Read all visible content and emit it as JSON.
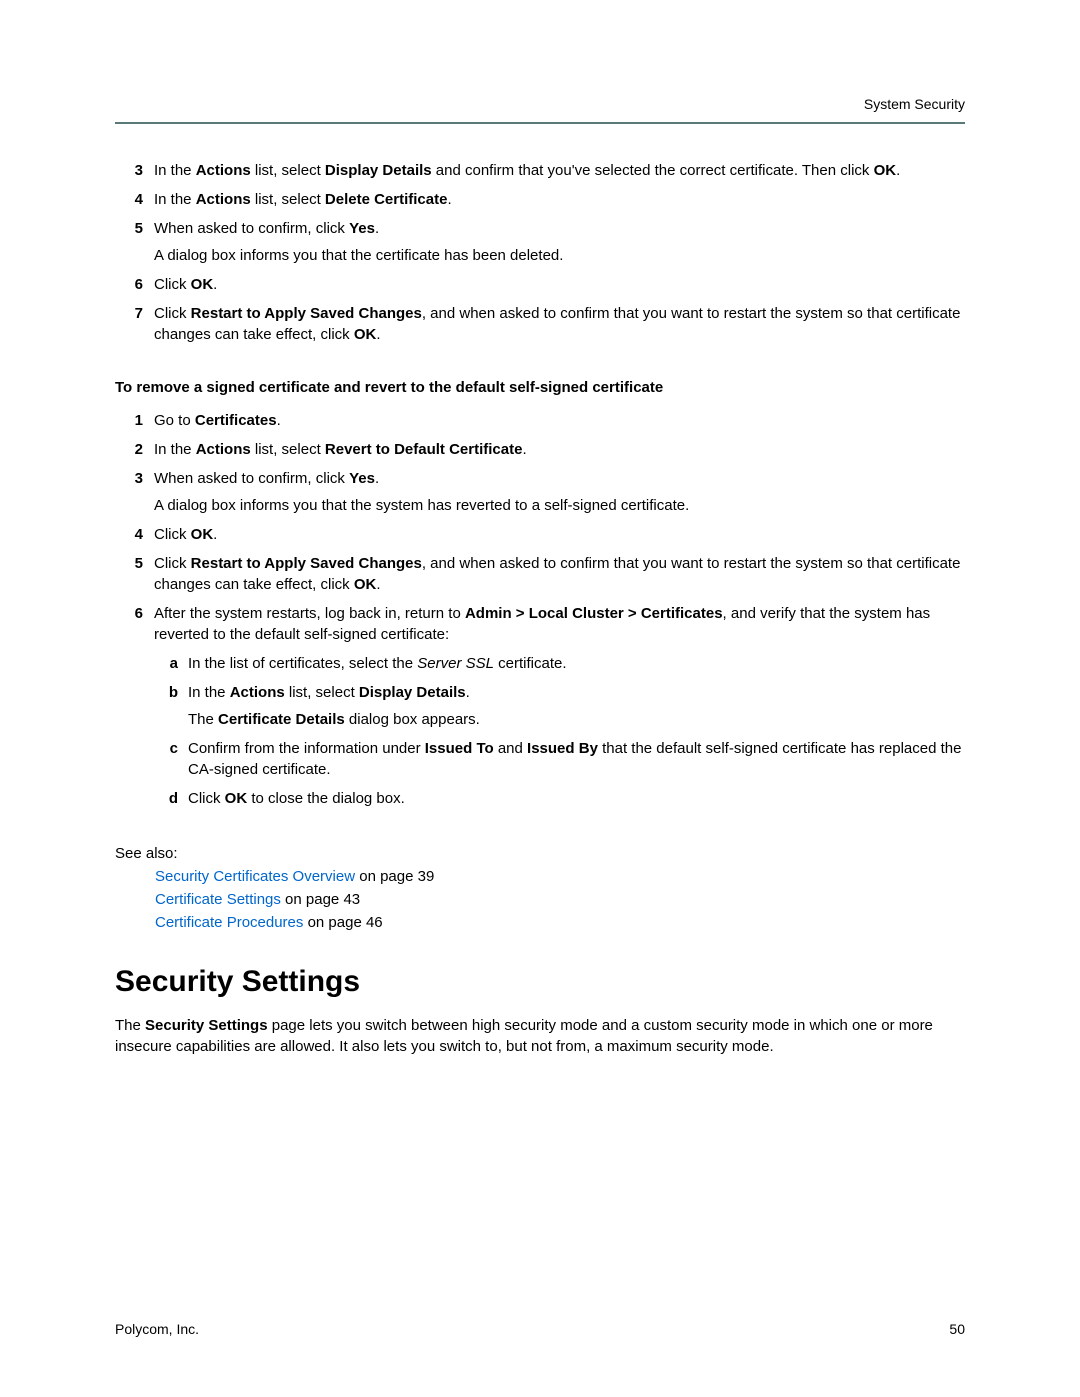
{
  "header": {
    "section": "System Security"
  },
  "listA": {
    "3a": "In the ",
    "3b": "Actions",
    "3c": " list, select ",
    "3d": "Display Details",
    "3e": " and confirm that you've selected the correct certificate. Then click ",
    "3f": "OK",
    "3g": ".",
    "4a": "In the ",
    "4b": "Actions",
    "4c": " list, select ",
    "4d": "Delete Certificate",
    "4e": ".",
    "5a": "When asked to confirm, click ",
    "5b": "Yes",
    "5c": ".",
    "5para": "A dialog box informs you that the certificate has been deleted.",
    "6a": "Click ",
    "6b": "OK",
    "6c": ".",
    "7a": "Click ",
    "7b": "Restart to Apply Saved Changes",
    "7c": ", and when asked to confirm that you want to restart the system so that certificate changes can take effect, click ",
    "7d": "OK",
    "7e": "."
  },
  "procHeading": "To remove a signed certificate and revert to the default self-signed certificate",
  "listB": {
    "1a": "Go to ",
    "1b": "Certificates",
    "1c": ".",
    "2a": "In the ",
    "2b": "Actions",
    "2c": " list, select ",
    "2d": "Revert to Default Certificate",
    "2e": ".",
    "3a": "When asked to confirm, click ",
    "3b": "Yes",
    "3c": ".",
    "3para": "A dialog box informs you that the system has reverted to a self-signed certificate.",
    "4a": "Click ",
    "4b": "OK",
    "4c": ".",
    "5a": "Click ",
    "5b": "Restart to Apply Saved Changes",
    "5c": ", and when asked to confirm that you want to restart the system so that certificate changes can take effect, click ",
    "5d": "OK",
    "5e": ".",
    "6a": "After the system restarts, log back in, return to ",
    "6b": "Admin > Local Cluster > Certificates",
    "6c": ", and verify that the system has reverted to the default self-signed certificate:",
    "6Aa": "In the list of certificates, select the ",
    "6Ab": "Server SSL",
    "6Ac": " certificate.",
    "6Ba": "In the ",
    "6Bb": "Actions",
    "6Bc": " list, select ",
    "6Bd": "Display Details",
    "6Be": ".",
    "6Bpara_a": "The ",
    "6Bpara_b": "Certificate Details",
    "6Bpara_c": " dialog box appears.",
    "6Ca": "Confirm from the information under ",
    "6Cb": "Issued To",
    "6Cc": " and ",
    "6Cd": "Issued By",
    "6Ce": " that the default self-signed certificate has replaced the CA-signed certificate.",
    "6Da": "Click ",
    "6Db": "OK",
    "6Dc": " to close the dialog box."
  },
  "seeAlso": "See also:",
  "links": {
    "l1": "Security Certificates Overview",
    "l1p": " on page 39",
    "l2": "Certificate Settings",
    "l2p": " on page 43",
    "l3": "Certificate Procedures",
    "l3p": " on page 46"
  },
  "h1": "Security Settings",
  "intro_a": "The ",
  "intro_b": "Security Settings",
  "intro_c": " page lets you switch between high security mode and a custom security mode in which one or more insecure capabilities are allowed. It also lets you switch to, but not from, a maximum security mode.",
  "footer": {
    "left": "Polycom, Inc.",
    "right": "50"
  }
}
